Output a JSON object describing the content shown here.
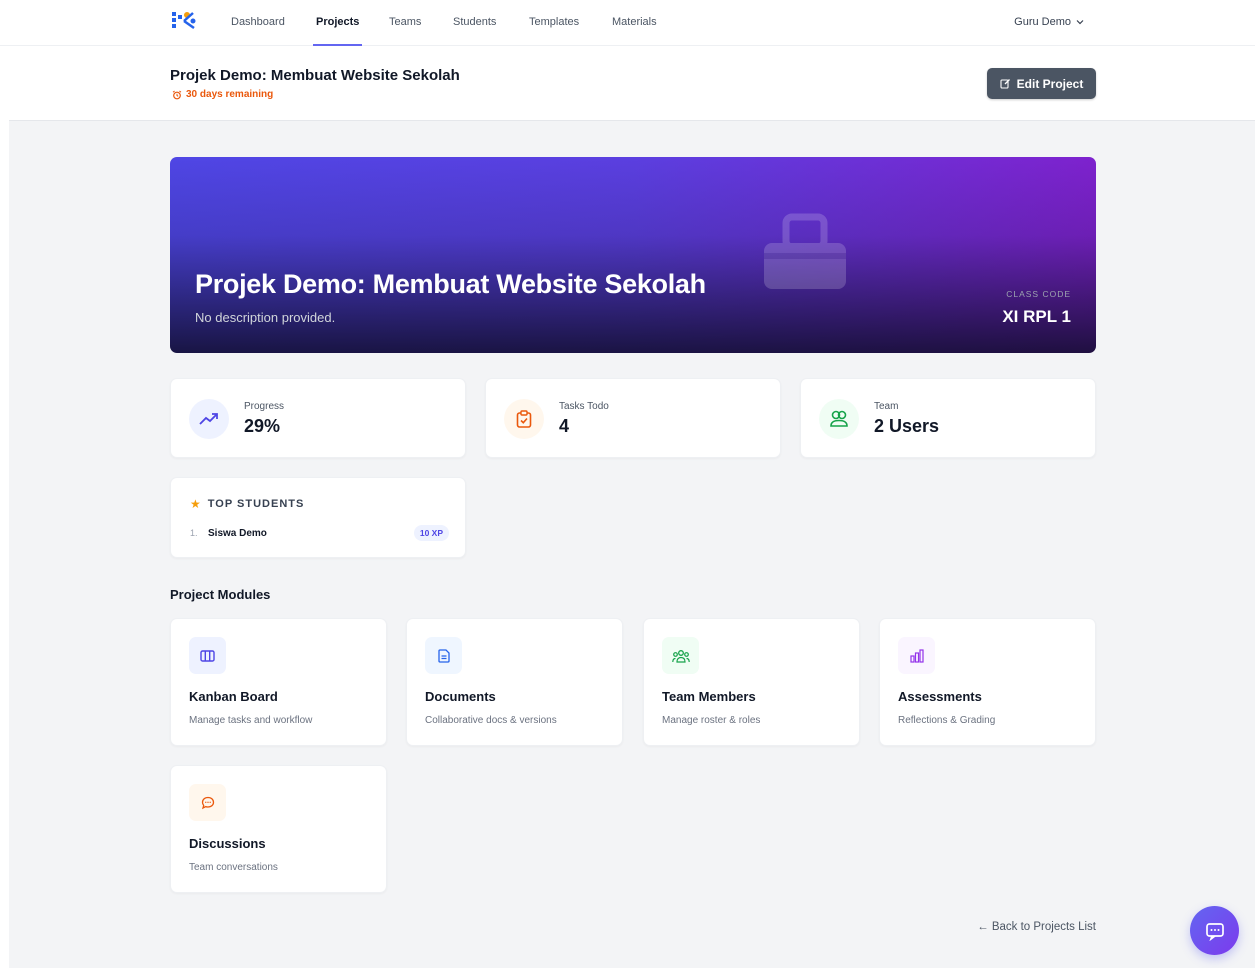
{
  "nav": {
    "items": [
      {
        "label": "Dashboard",
        "active": false
      },
      {
        "label": "Projects",
        "active": true
      },
      {
        "label": "Teams",
        "active": false
      },
      {
        "label": "Students",
        "active": false
      },
      {
        "label": "Templates",
        "active": false
      },
      {
        "label": "Materials",
        "active": false
      }
    ],
    "user": "Guru Demo"
  },
  "header": {
    "title": "Projek Demo: Membuat Website Sekolah",
    "remaining": "30 days remaining",
    "edit_label": "Edit Project"
  },
  "hero": {
    "title": "Projek Demo: Membuat Website Sekolah",
    "description": "No description provided.",
    "class_code_label": "CLASS CODE",
    "class_code": "XI RPL 1"
  },
  "stats": [
    {
      "label": "Progress",
      "value": "29%",
      "icon": "trending-up-icon",
      "color": "#4f46e5"
    },
    {
      "label": "Tasks Todo",
      "value": "4",
      "icon": "clipboard-check-icon",
      "color": "#ea580c"
    },
    {
      "label": "Team",
      "value": "2 Users",
      "icon": "users-icon",
      "color": "#16a34a"
    }
  ],
  "top_students": {
    "title": "TOP STUDENTS",
    "items": [
      {
        "rank": "1.",
        "name": "Siswa Demo",
        "xp": "10 XP"
      }
    ]
  },
  "modules": {
    "title": "Project Modules",
    "items": [
      {
        "title": "Kanban Board",
        "description": "Manage tasks and workflow",
        "icon": "kanban-icon",
        "color": "#4f46e5"
      },
      {
        "title": "Documents",
        "description": "Collaborative docs & versions",
        "icon": "document-icon",
        "color": "#2563eb"
      },
      {
        "title": "Team Members",
        "description": "Manage roster & roles",
        "icon": "user-group-icon",
        "color": "#16a34a"
      },
      {
        "title": "Assessments",
        "description": "Reflections & Grading",
        "icon": "bar-chart-icon",
        "color": "#9333ea"
      },
      {
        "title": "Discussions",
        "description": "Team conversations",
        "icon": "chat-bubble-icon",
        "color": "#ea580c"
      }
    ]
  },
  "back_link": "← Back to Projects List"
}
